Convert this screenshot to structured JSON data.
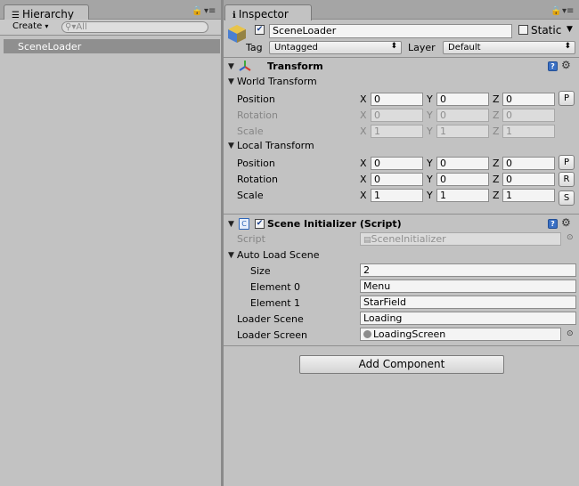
{
  "hierarchy": {
    "tab_label": "Hierarchy",
    "create_label": "Create",
    "search_placeholder": "All",
    "items": [
      {
        "label": "SceneLoader",
        "selected": true
      }
    ]
  },
  "inspector": {
    "tab_label": "Inspector",
    "object": {
      "name": "SceneLoader",
      "static_label": "Static",
      "tag_label": "Tag",
      "tag_value": "Untagged",
      "layer_label": "Layer",
      "layer_value": "Default"
    },
    "transform": {
      "title": "Transform",
      "world_label": "World Transform",
      "local_label": "Local Transform",
      "world": {
        "position": {
          "label": "Position",
          "x": "0",
          "y": "0",
          "z": "0",
          "button": "P"
        },
        "rotation": {
          "label": "Rotation",
          "x": "0",
          "y": "0",
          "z": "0"
        },
        "scale": {
          "label": "Scale",
          "x": "1",
          "y": "1",
          "z": "1"
        }
      },
      "local": {
        "position": {
          "label": "Position",
          "x": "0",
          "y": "0",
          "z": "0",
          "button": "P"
        },
        "rotation": {
          "label": "Rotation",
          "x": "0",
          "y": "0",
          "z": "0",
          "button": "R"
        },
        "scale": {
          "label": "Scale",
          "x": "1",
          "y": "1",
          "z": "1",
          "button": "S"
        }
      },
      "axis": {
        "x": "X",
        "y": "Y",
        "z": "Z"
      }
    },
    "script_component": {
      "title": "Scene Initializer (Script)",
      "script_label": "Script",
      "script_value": "SceneInitializer",
      "auto_load_label": "Auto Load Scene",
      "size_label": "Size",
      "size_value": "2",
      "element0_label": "Element 0",
      "element0_value": "Menu",
      "element1_label": "Element 1",
      "element1_value": "StarField",
      "loader_scene_label": "Loader Scene",
      "loader_scene_value": "Loading",
      "loader_screen_label": "Loader Screen",
      "loader_screen_value": "LoadingScreen"
    },
    "add_component_label": "Add Component"
  },
  "colors": {
    "panel_bg": "#c2c2c2",
    "selection": "#8f8f8f",
    "tab_strip": "#a5a5a5"
  }
}
